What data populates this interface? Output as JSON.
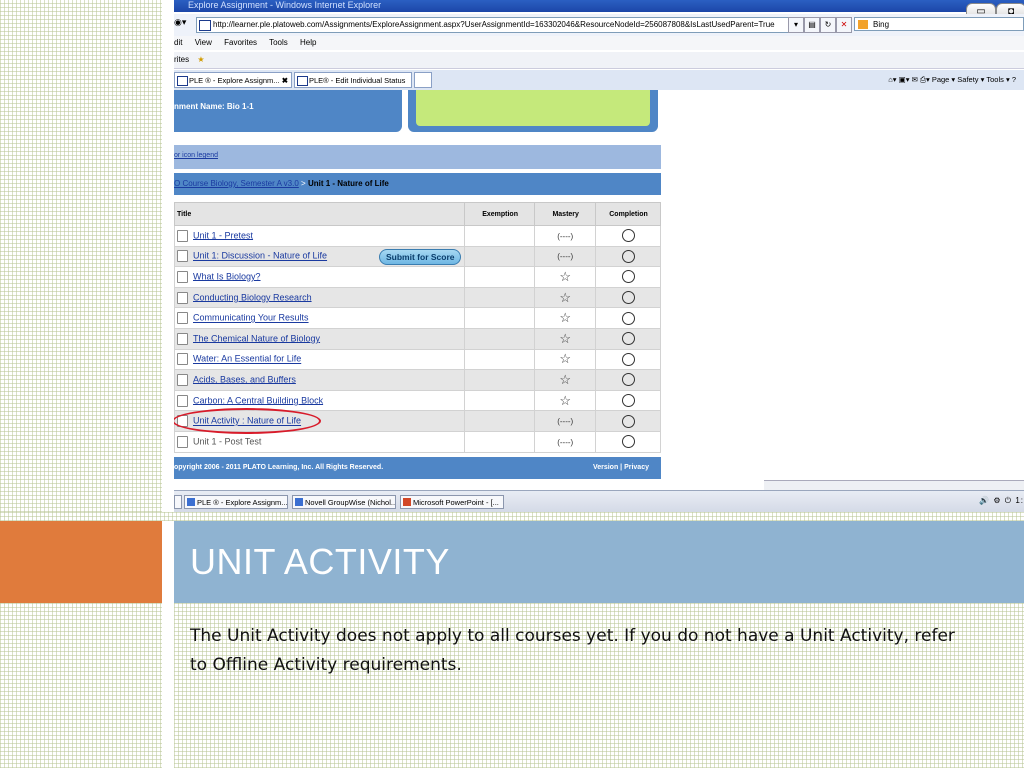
{
  "slide": {
    "title": "UNIT ACTIVITY",
    "body": "The Unit Activity does not apply to all courses yet. If you do not have a Unit Activity, refer to Offline Activity requirements.",
    "colors": {
      "orange": "#e07b3c",
      "blue_band": "#8fb3d1",
      "pattern": "#bac696"
    }
  },
  "browser": {
    "window_title": "Explore Assignment - Windows Internet Explorer",
    "address": "http://learner.ple.platoweb.com/Assignments/ExploreAssignment.aspx?UserAssignmentId=163302046&ResourceNodeId=256087808&IsLastUsedParent=True",
    "search_placeholder": "Bing",
    "menu": [
      "dit",
      "View",
      "Favorites",
      "Tools",
      "Help"
    ],
    "favorites_label": "rites",
    "tabs": [
      {
        "label": "PLE ® - Explore Assignm...",
        "close": "✖"
      },
      {
        "label": "PLE® - Edit Individual Status"
      }
    ],
    "commands": [
      "Page ▾",
      "Safety ▾",
      "Tools ▾",
      "?"
    ]
  },
  "page": {
    "assignment_name": "nment Name:  Bio 1-1",
    "legend_link": "or icon legend",
    "breadcrumb": {
      "link": "O Course Biology, Semester A v3.0",
      "separator": " > ",
      "current": "Unit 1 - Nature of Life"
    },
    "table": {
      "headers": [
        "Title",
        "Exemption",
        "Mastery",
        "Completion"
      ],
      "submit_button": "Submit for Score",
      "rows": [
        {
          "title": "Unit 1 - Pretest",
          "linked": true,
          "mastery": "dash"
        },
        {
          "title": "Unit 1: Discussion - Nature of Life",
          "linked": true,
          "mastery": "dash",
          "submit": true
        },
        {
          "title": "What Is Biology?",
          "linked": true,
          "mastery": "star"
        },
        {
          "title": "Conducting Biology Research",
          "linked": true,
          "mastery": "star"
        },
        {
          "title": "Communicating Your Results",
          "linked": true,
          "mastery": "star"
        },
        {
          "title": "The Chemical Nature of Biology",
          "linked": true,
          "mastery": "star"
        },
        {
          "title": "Water: An Essential for Life",
          "linked": true,
          "mastery": "star"
        },
        {
          "title": "Acids, Bases, and Buffers",
          "linked": true,
          "mastery": "star"
        },
        {
          "title": "Carbon: A Central Building Block",
          "linked": true,
          "mastery": "star"
        },
        {
          "title": "Unit Activity : Nature of Life",
          "linked": true,
          "mastery": "dash",
          "highlighted": true
        },
        {
          "title": "Unit 1 - Post Test",
          "linked": false,
          "mastery": "dash"
        }
      ],
      "dash_text": "(----)"
    },
    "footer_left": "opyright 2006 - 2011 PLATO Learning, Inc. All Rights Reserved.",
    "footer_right": "Version | Privacy"
  },
  "taskbar": {
    "items": [
      "PLE ® - Explore Assignm...",
      "Novell GroupWise (Nichol...",
      "Microsoft PowerPoint - [..."
    ],
    "tray": "🔊 ⚙ ⏻ 1:"
  }
}
